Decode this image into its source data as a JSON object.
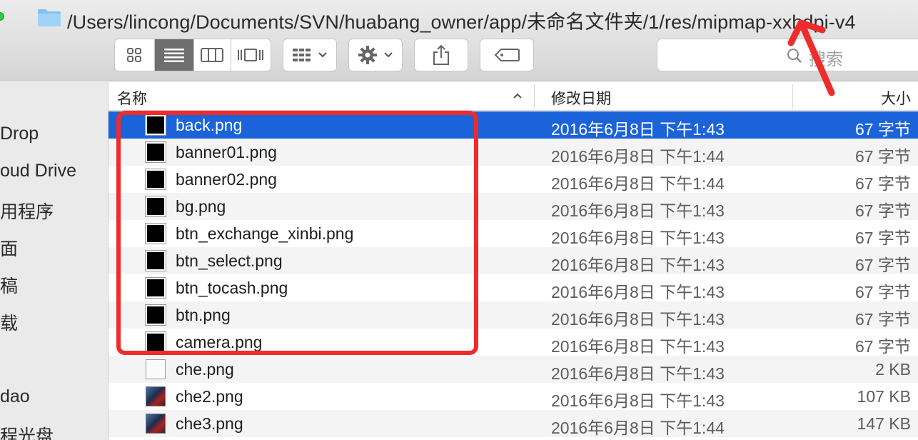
{
  "window": {
    "path": "/Users/lincong/Documents/SVN/huabang_owner/app/未命名文件夹/1/res/mipmap-xxhdpi-v4"
  },
  "toolbar": {
    "view_icons": [
      "icon-view-icon",
      "list-view-icon",
      "column-view-icon",
      "cover-flow-icon"
    ],
    "active_view": "list-view-icon",
    "search_placeholder": "搜索"
  },
  "sidebar": {
    "items": [
      {
        "label": "Drop"
      },
      {
        "label": "oud Drive"
      },
      {
        "label": "用程序"
      },
      {
        "label": "面"
      },
      {
        "label": "稿"
      },
      {
        "label": "载"
      },
      {
        "label": "dao"
      },
      {
        "label": "程光盘"
      }
    ]
  },
  "columns": {
    "name": "名称",
    "date": "修改日期",
    "size": "大小"
  },
  "files": [
    {
      "name": "back.png",
      "date": "2016年6月8日 下午1:43",
      "size": "67 字节",
      "icon": "black"
    },
    {
      "name": "banner01.png",
      "date": "2016年6月8日 下午1:44",
      "size": "67 字节",
      "icon": "black"
    },
    {
      "name": "banner02.png",
      "date": "2016年6月8日 下午1:44",
      "size": "67 字节",
      "icon": "black"
    },
    {
      "name": "bg.png",
      "date": "2016年6月8日 下午1:43",
      "size": "67 字节",
      "icon": "black"
    },
    {
      "name": "btn_exchange_xinbi.png",
      "date": "2016年6月8日 下午1:43",
      "size": "67 字节",
      "icon": "black"
    },
    {
      "name": "btn_select.png",
      "date": "2016年6月8日 下午1:43",
      "size": "67 字节",
      "icon": "black"
    },
    {
      "name": "btn_tocash.png",
      "date": "2016年6月8日 下午1:43",
      "size": "67 字节",
      "icon": "black"
    },
    {
      "name": "btn.png",
      "date": "2016年6月8日 下午1:43",
      "size": "67 字节",
      "icon": "black"
    },
    {
      "name": "camera.png",
      "date": "2016年6月8日 下午1:43",
      "size": "67 字节",
      "icon": "black"
    },
    {
      "name": "che.png",
      "date": "2016年6月8日 下午1:43",
      "size": "2 KB",
      "icon": "doc"
    },
    {
      "name": "che2.png",
      "date": "2016年6月8日 下午1:43",
      "size": "107 KB",
      "icon": "photo"
    },
    {
      "name": "che3.png",
      "date": "2016年6月8日 下午1:44",
      "size": "147 KB",
      "icon": "photo"
    }
  ],
  "selected_index": 0,
  "colors": {
    "selection": "#1b63d8",
    "annotation": "#ef2b2b"
  }
}
